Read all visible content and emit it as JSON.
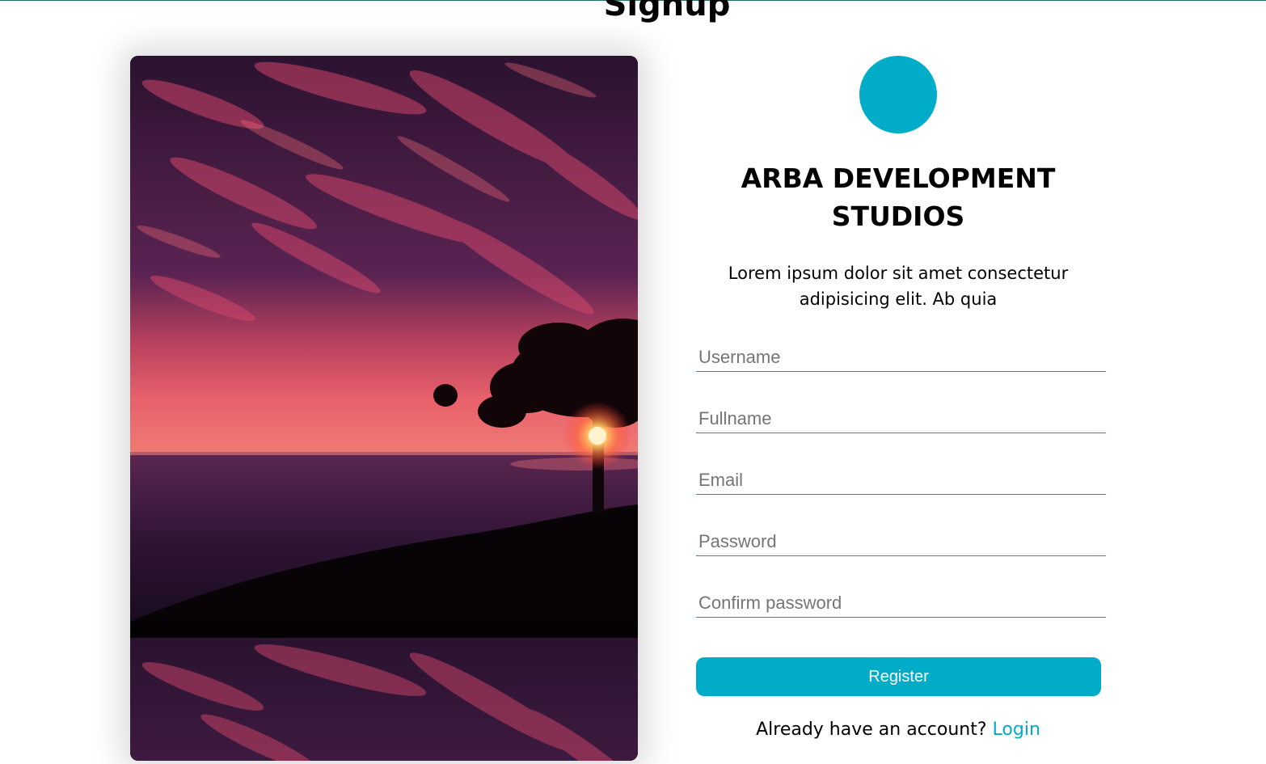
{
  "page": {
    "title": "Signup"
  },
  "brand": {
    "name": "ARBA DEVELOPMENT STUDIOS",
    "tagline": "Lorem ipsum dolor sit amet consectetur adipisicing elit. Ab quia",
    "accent_color": "#00acc8",
    "underline_color": "#1a9a9a"
  },
  "form": {
    "fields": [
      {
        "name": "username",
        "placeholder": "Username",
        "value": ""
      },
      {
        "name": "fullname",
        "placeholder": "Fullname",
        "value": ""
      },
      {
        "name": "email",
        "placeholder": "Email",
        "value": ""
      },
      {
        "name": "password",
        "placeholder": "Password",
        "value": ""
      },
      {
        "name": "confirm_password",
        "placeholder": "Confirm password",
        "value": ""
      }
    ],
    "submit_label": "Register"
  },
  "footer": {
    "prompt": "Already have an account?",
    "login_label": "Login"
  },
  "image": {
    "subject": "sunset-tree-over-sea-photo"
  }
}
